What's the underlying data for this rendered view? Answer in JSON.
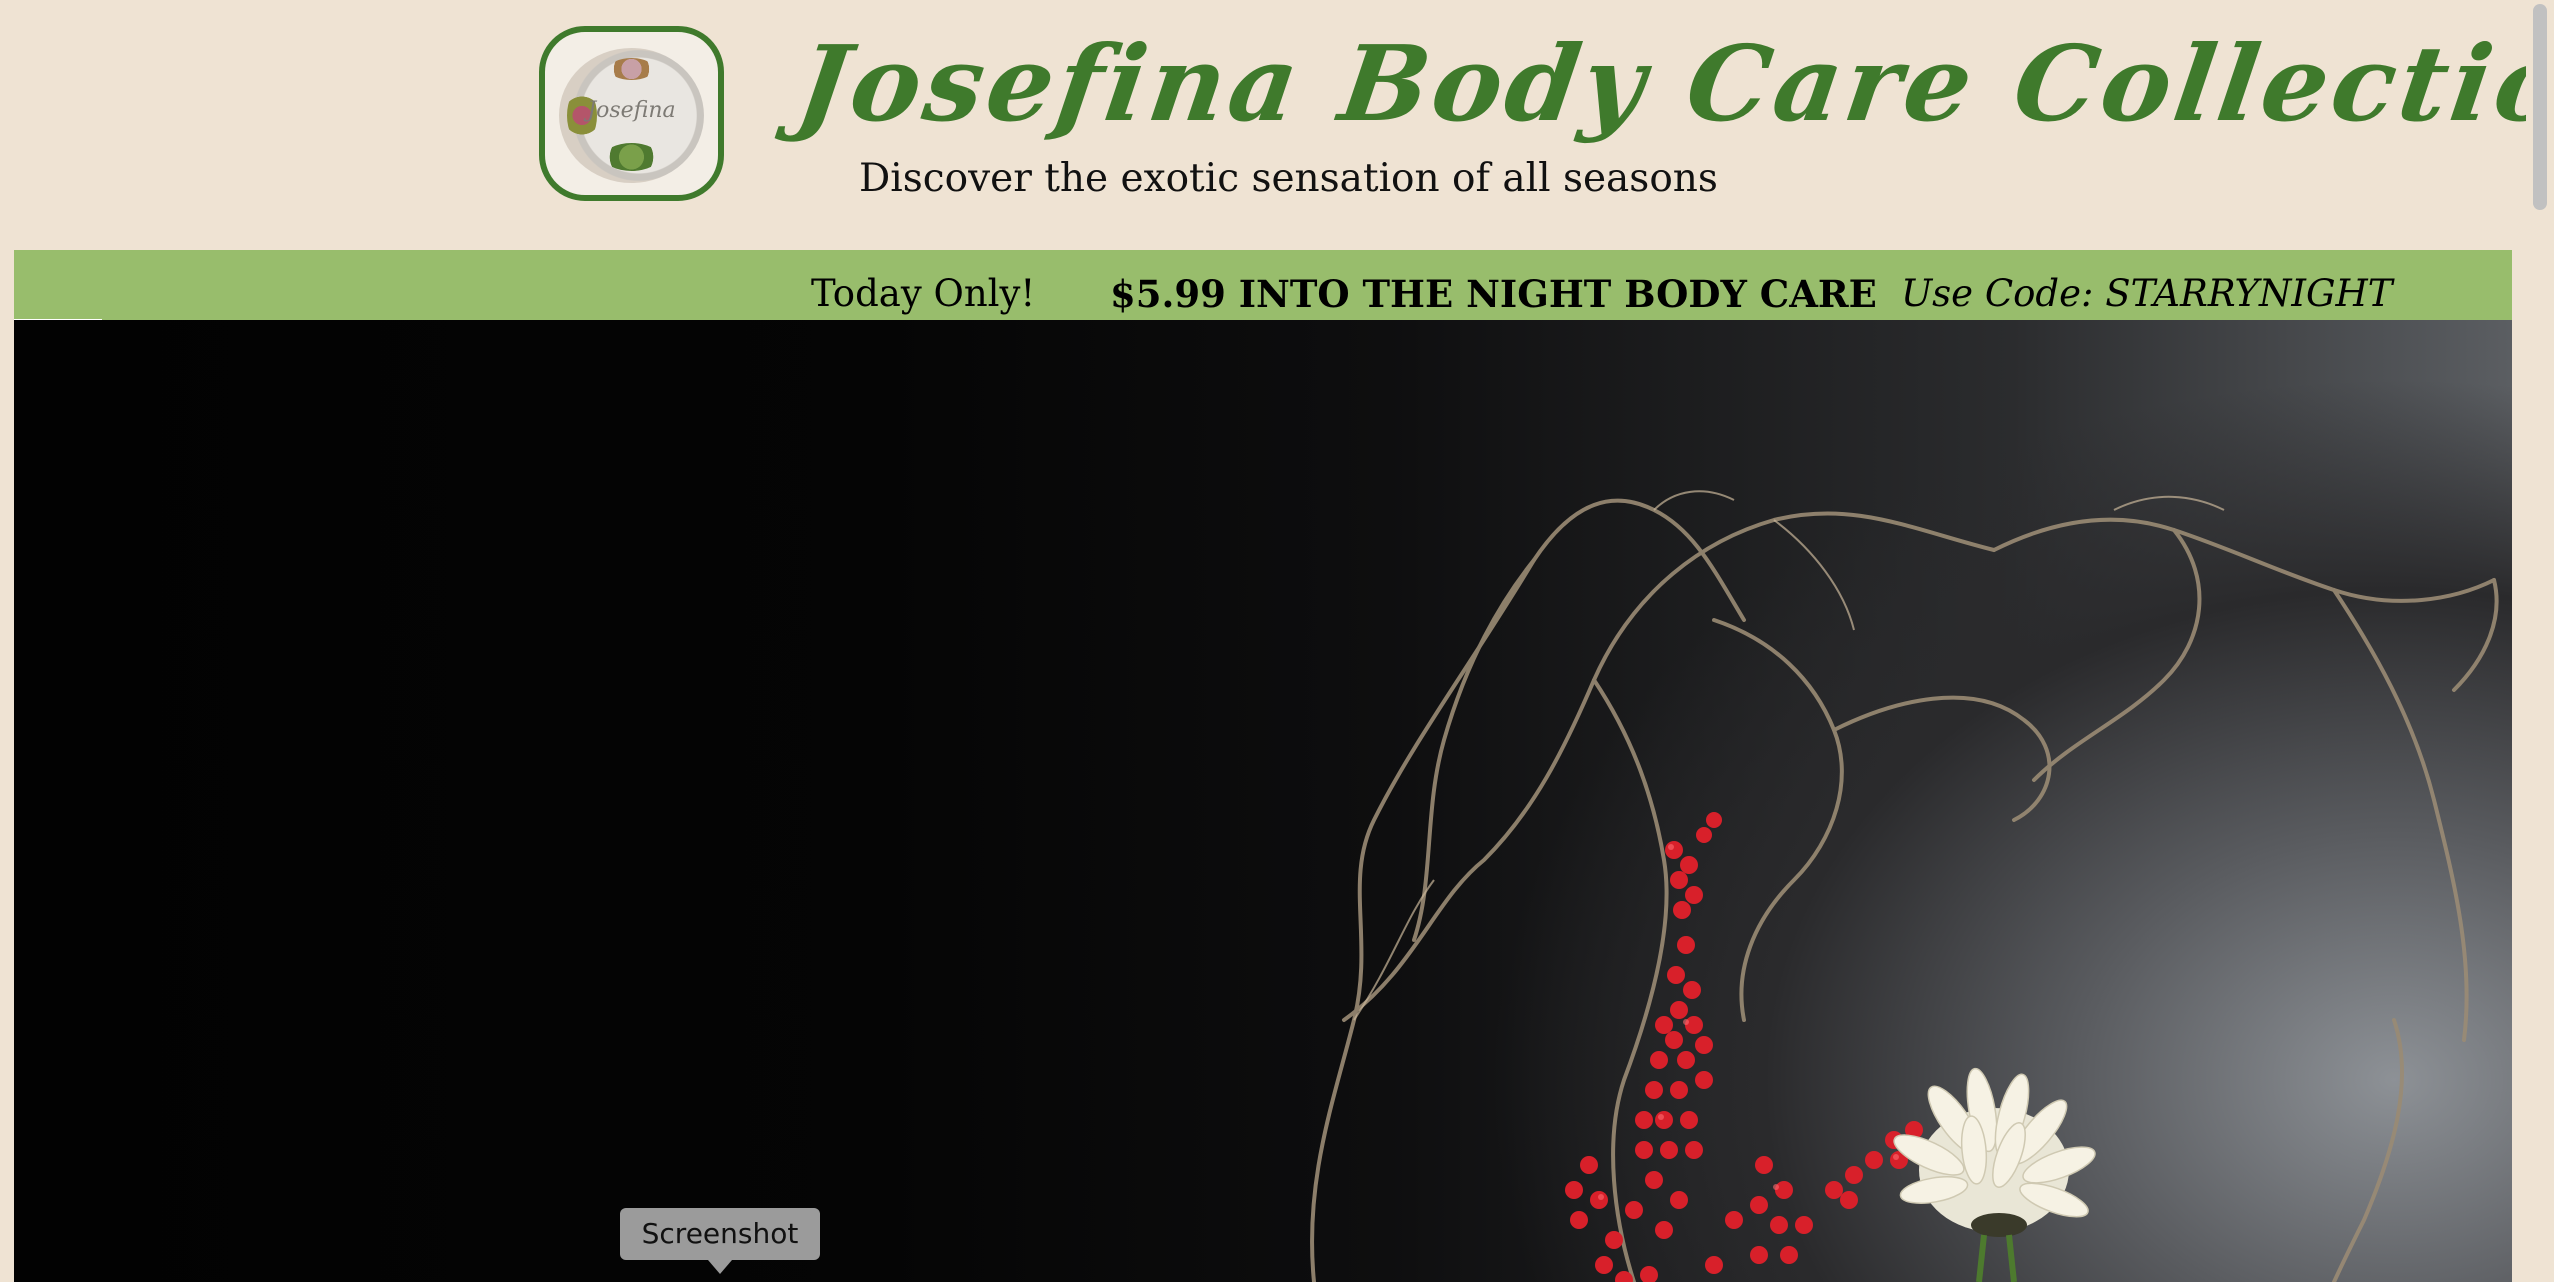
{
  "header": {
    "logo_text": "Josefina",
    "title": "Josefina Body Care Collection",
    "tagline": "Discover the exotic sensation of all seasons"
  },
  "promo": {
    "today": "Today Only!",
    "offer": "$5.99 INTO THE NIGHT BODY CARE",
    "code": "Use Code: STARRYNIGHT"
  },
  "hero": {
    "subject": "curly willow branches, red winterberries and a white chrysanthemum on a dark background"
  },
  "tooltip": {
    "label": "Screenshot"
  },
  "colors": {
    "brand_green": "#3f7a2c",
    "promo_green": "#98bd6c",
    "background_cream": "#efe3d3"
  }
}
